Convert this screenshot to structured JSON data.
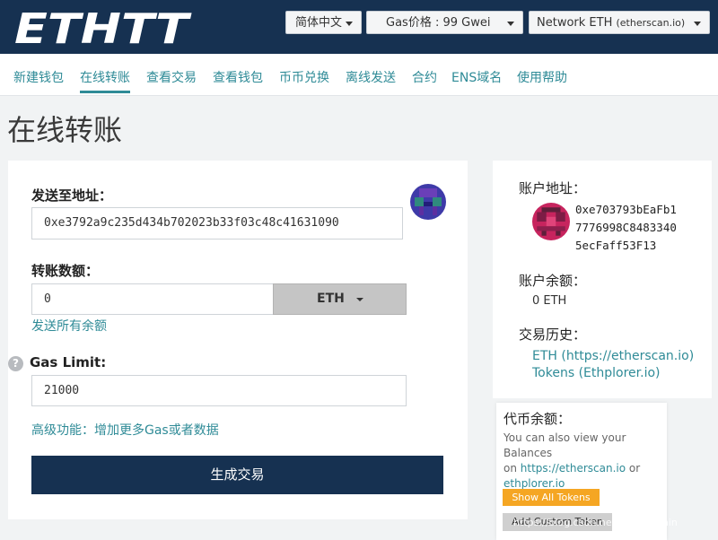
{
  "header": {
    "logo": "ETHTT",
    "language": "简体中文",
    "gas": "Gas价格 : 99 Gwei",
    "network_main": "Network ETH",
    "network_sub": "(etherscan.io)"
  },
  "nav": {
    "items": [
      "新建钱包",
      "在线转账",
      "查看交易",
      "查看钱包",
      "币币兑换",
      "离线发送",
      "合约",
      "ENS域名",
      "使用帮助"
    ],
    "active_index": 1
  },
  "page": {
    "title": "在线转账"
  },
  "form": {
    "to_label": "发送至地址：",
    "to_value": "0xe3792a9c235d434b702023b33f03c48c41631090",
    "amount_label": "转账数额：",
    "amount_value": "0",
    "currency": "ETH",
    "send_all": "发送所有余额",
    "gas_label": "Gas Limit:",
    "gas_value": "21000",
    "advanced": "高级功能：增加更多Gas或者数据",
    "generate": "生成交易"
  },
  "account": {
    "address_label": "账户地址：",
    "address_lines": [
      "0xe703793bEaFb1",
      "7776998C8483340",
      "5ecFaff53F13"
    ],
    "balance_label": "账户余额：",
    "balance_value": "0 ETH",
    "history_label": "交易历史：",
    "history_links": [
      "ETH (https://etherscan.io)",
      "Tokens (Ethplorer.io)"
    ]
  },
  "tokens": {
    "title": "代币余额：",
    "desc_1": "You can also view your Balances",
    "desc_2_pre": "on ",
    "desc_2_link": "https://etherscan.io",
    "desc_2_post": " or",
    "desc_3_link": "ethplorer.io",
    "show_all": "Show All Tokens",
    "add_custom": "Add Custom Token"
  },
  "watermark": "https://blog.csdn.net/bps_ad_min",
  "colors": {
    "navy": "#163151",
    "teal": "#2f8b97",
    "orange": "#f5a623"
  }
}
